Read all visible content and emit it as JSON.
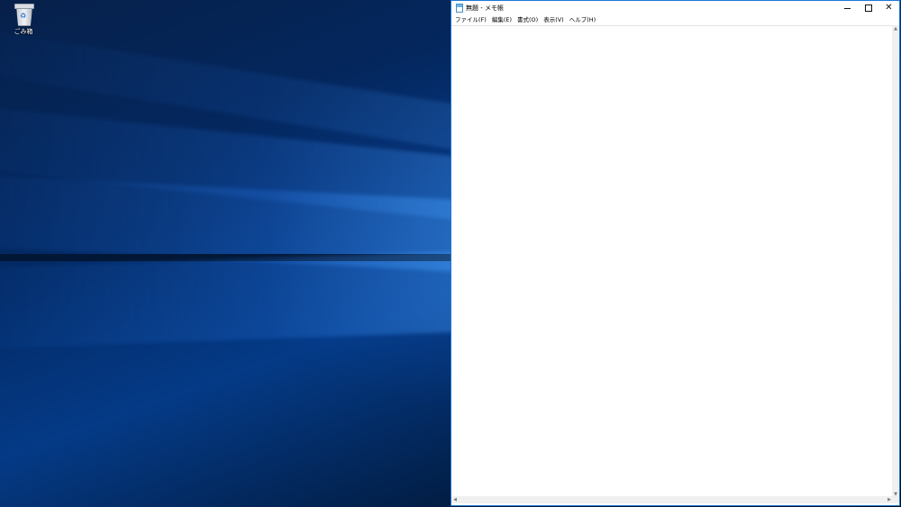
{
  "desktop": {
    "icons": [
      {
        "label": "ごみ箱",
        "icon": "recycle-bin-icon"
      }
    ]
  },
  "notepad": {
    "title": "無題 - メモ帳",
    "app_icon": "notepad-icon",
    "window_controls": {
      "minimize": "minimize-icon",
      "maximize": "maximize-icon",
      "close": "close-icon"
    },
    "menu": [
      {
        "label": "ファイル(F)"
      },
      {
        "label": "編集(E)"
      },
      {
        "label": "書式(O)"
      },
      {
        "label": "表示(V)"
      },
      {
        "label": "ヘルプ(H)"
      }
    ],
    "content": ""
  },
  "colors": {
    "window_border": "#1f78d1",
    "desktop_accent": "#0a5bd6"
  }
}
